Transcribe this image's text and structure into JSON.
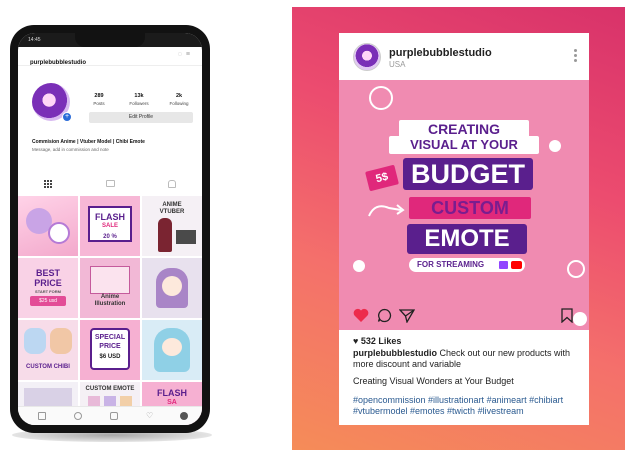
{
  "phone": {
    "status_time": "14:45",
    "status_right": "",
    "username": "purplebubblestudio",
    "stats": [
      {
        "num": "289",
        "label": "Posts"
      },
      {
        "num": "13k",
        "label": "Followers"
      },
      {
        "num": "2k",
        "label": "Following"
      }
    ],
    "edit_profile_label": "Edit Profile",
    "bio_name": "Commision Anime | Vtuber Model | Chibi Emote",
    "bio_text": "Message, add in commission and note",
    "tiles": [
      {
        "line1": "",
        "line2": ""
      },
      {
        "line1": "FLASH",
        "line2": "SALE",
        "line3": "20 %"
      },
      {
        "line1": "ANIME",
        "line2": "VTUBER"
      },
      {
        "line1": "BEST",
        "line2": "PRICE",
        "line3": "START FORM",
        "line4": "$25 usd"
      },
      {
        "line1": "Anime",
        "line2": "Illustration"
      },
      {
        "line1": "",
        "line2": ""
      },
      {
        "line1": "CUSTOM CHIBI"
      },
      {
        "line1": "SPECIAL",
        "line2": "PRICE",
        "line3": "$6 USD"
      },
      {
        "line1": ""
      },
      {
        "line1": ""
      },
      {
        "line1": "CUSTOM EMOTE"
      },
      {
        "line1": "FLASH",
        "line2": "SA"
      }
    ]
  },
  "post": {
    "username": "purplebubblestudio",
    "location": "USA",
    "image": {
      "line1": "CREATING",
      "line2": "VISUAL AT YOUR",
      "line3": "BUDGET",
      "line4": "CUSTOM",
      "line5": "EMOTE",
      "line6": "FOR STREAMING",
      "price_tag": "5$"
    },
    "likes": "532 Likes",
    "caption_user": "purplebubblestudio",
    "caption_text": " Check out our new products with more discount and variable",
    "tagline": "Creating Visual Wonders at Your Budget",
    "hashtags": "#opencommission #illustrationart #animeart #chibiart #vtubermodel #emotes #twicth #livestream"
  },
  "colors": {
    "brand_purple": "#5a1f8d",
    "post_pink": "#f08bb1",
    "heart_red": "#ed2b4c",
    "hashtag_blue": "#2a5a90"
  }
}
